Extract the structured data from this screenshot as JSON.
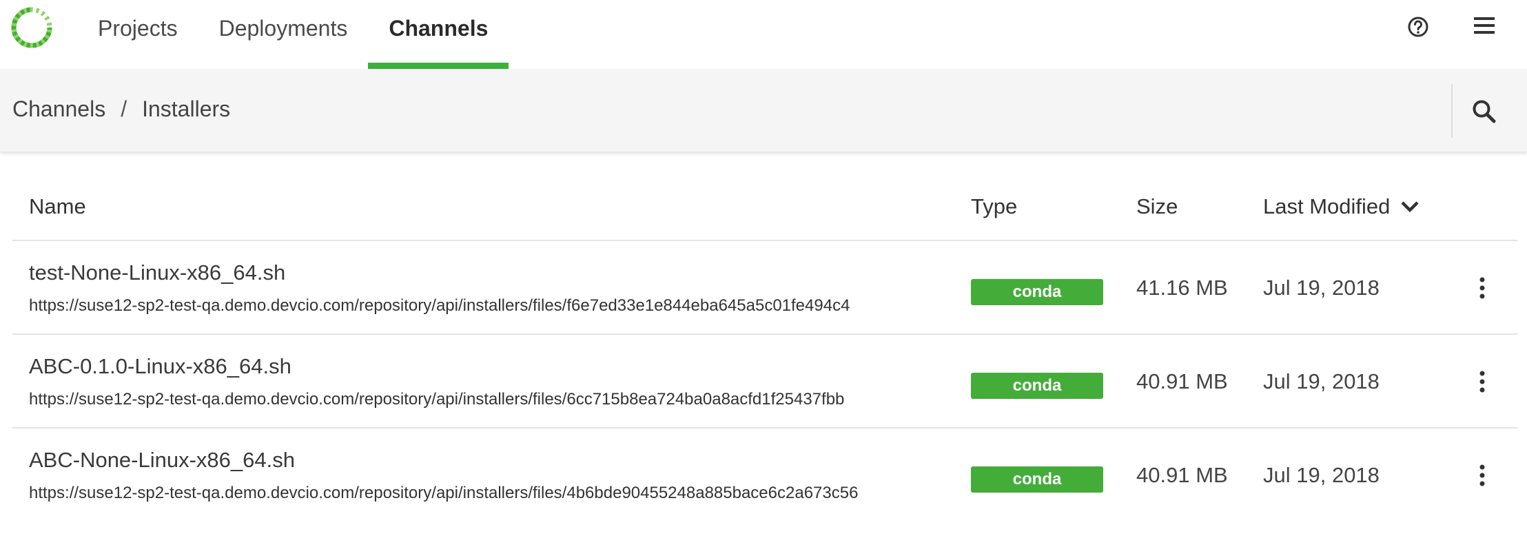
{
  "nav": {
    "items": [
      {
        "label": "Projects",
        "active": false
      },
      {
        "label": "Deployments",
        "active": false
      },
      {
        "label": "Channels",
        "active": true
      }
    ]
  },
  "colors": {
    "accent": "#3bb03b",
    "badge": "#44ad3a"
  },
  "icons": {
    "logo": "ring-logo-icon",
    "help": "help-circle-icon",
    "menu": "hamburger-menu-icon",
    "search": "search-icon",
    "sort": "chevron-down-icon",
    "row_actions": "kebab-menu-icon"
  },
  "breadcrumb": {
    "root": "Channels",
    "separator": "/",
    "current": "Installers"
  },
  "table": {
    "headers": {
      "name": "Name",
      "type": "Type",
      "size": "Size",
      "modified": "Last Modified"
    },
    "sort": {
      "column": "Last Modified",
      "direction": "descending"
    },
    "rows": [
      {
        "name": "test-None-Linux-x86_64.sh",
        "url": "https://suse12-sp2-test-qa.demo.devcio.com/repository/api/installers/files/f6e7ed33e1e844eba645a5c01fe494c4",
        "type": "conda",
        "size": "41.16 MB",
        "modified": "Jul 19, 2018"
      },
      {
        "name": "ABC-0.1.0-Linux-x86_64.sh",
        "url": "https://suse12-sp2-test-qa.demo.devcio.com/repository/api/installers/files/6cc715b8ea724ba0a8acfd1f25437fbb",
        "type": "conda",
        "size": "40.91 MB",
        "modified": "Jul 19, 2018"
      },
      {
        "name": "ABC-None-Linux-x86_64.sh",
        "url": "https://suse12-sp2-test-qa.demo.devcio.com/repository/api/installers/files/4b6bde90455248a885bace6c2a673c56",
        "type": "conda",
        "size": "40.91 MB",
        "modified": "Jul 19, 2018"
      }
    ]
  }
}
